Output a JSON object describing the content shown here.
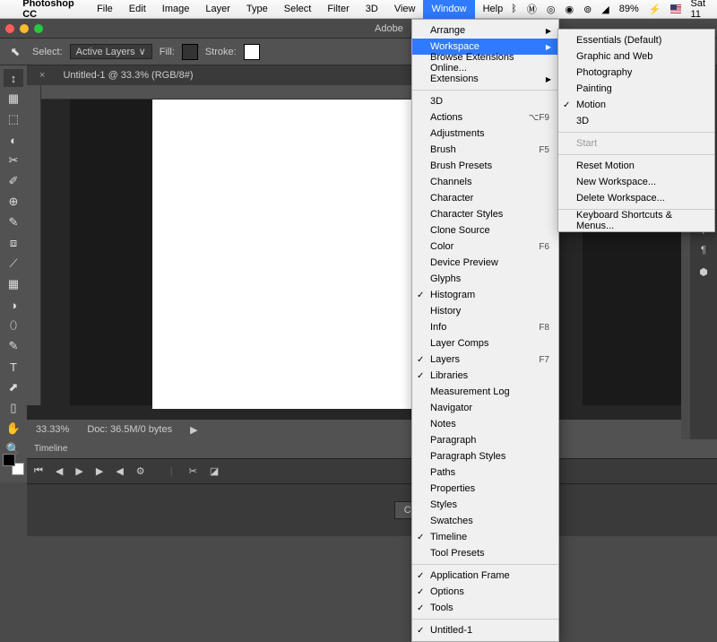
{
  "menubar": {
    "app": "Photoshop CC",
    "items": [
      "File",
      "Edit",
      "Image",
      "Layer",
      "Type",
      "Select",
      "Filter",
      "3D",
      "View",
      "Window",
      "Help"
    ],
    "open": "Window"
  },
  "sys": {
    "battery": "89%",
    "charging": "⚡",
    "day": "Sat 11"
  },
  "title": "Adobe",
  "options": {
    "select_label": "Select:",
    "select_value": "Active Layers",
    "fill_label": "Fill:",
    "stroke_label": "Stroke:"
  },
  "tab": {
    "name": "Untitled-1 @ 33.3% (RGB/8#)",
    "close": "×"
  },
  "status": {
    "zoom": "33.33%",
    "doc": "Doc: 36.5M/0 bytes"
  },
  "timeline": {
    "title": "Timeline",
    "button": "Create Video Timeline"
  },
  "window_menu": [
    {
      "label": "Arrange",
      "arrow": true
    },
    {
      "label": "Workspace",
      "arrow": true,
      "hl": true
    },
    {
      "label": "Browse Extensions Online..."
    },
    {
      "label": "Extensions",
      "arrow": true
    },
    {
      "sep": true
    },
    {
      "label": "3D"
    },
    {
      "label": "Actions",
      "sc": "⌥F9"
    },
    {
      "label": "Adjustments"
    },
    {
      "label": "Brush",
      "sc": "F5"
    },
    {
      "label": "Brush Presets"
    },
    {
      "label": "Channels"
    },
    {
      "label": "Character"
    },
    {
      "label": "Character Styles"
    },
    {
      "label": "Clone Source"
    },
    {
      "label": "Color",
      "sc": "F6"
    },
    {
      "label": "Device Preview"
    },
    {
      "label": "Glyphs"
    },
    {
      "label": "Histogram",
      "chk": true
    },
    {
      "label": "History"
    },
    {
      "label": "Info",
      "sc": "F8"
    },
    {
      "label": "Layer Comps"
    },
    {
      "label": "Layers",
      "sc": "F7",
      "chk": true
    },
    {
      "label": "Libraries",
      "chk": true
    },
    {
      "label": "Measurement Log"
    },
    {
      "label": "Navigator"
    },
    {
      "label": "Notes"
    },
    {
      "label": "Paragraph"
    },
    {
      "label": "Paragraph Styles"
    },
    {
      "label": "Paths"
    },
    {
      "label": "Properties"
    },
    {
      "label": "Styles"
    },
    {
      "label": "Swatches"
    },
    {
      "label": "Timeline",
      "chk": true
    },
    {
      "label": "Tool Presets"
    },
    {
      "sep": true
    },
    {
      "label": "Application Frame",
      "chk": true
    },
    {
      "label": "Options",
      "chk": true
    },
    {
      "label": "Tools",
      "chk": true
    },
    {
      "sep": true
    },
    {
      "label": "Untitled-1",
      "chk": true
    }
  ],
  "workspace_menu": [
    {
      "label": "Essentials (Default)"
    },
    {
      "label": "Graphic and Web"
    },
    {
      "label": "Photography"
    },
    {
      "label": "Painting"
    },
    {
      "label": "Motion",
      "chk": true
    },
    {
      "label": "3D"
    },
    {
      "sep": true
    },
    {
      "label": "Start",
      "dis": true
    },
    {
      "sep": true
    },
    {
      "label": "Reset Motion"
    },
    {
      "label": "New Workspace..."
    },
    {
      "label": "Delete Workspace..."
    },
    {
      "sep": true
    },
    {
      "label": "Keyboard Shortcuts & Menus..."
    }
  ],
  "tools": [
    "↕",
    "▦",
    "⬚",
    "◐",
    "✂",
    "✐",
    "⊕",
    "✎",
    "⧈",
    "⟋",
    "▦",
    "◑",
    "⬯",
    "✎",
    "T",
    "⬈",
    "▯",
    "✋",
    "🔍"
  ]
}
